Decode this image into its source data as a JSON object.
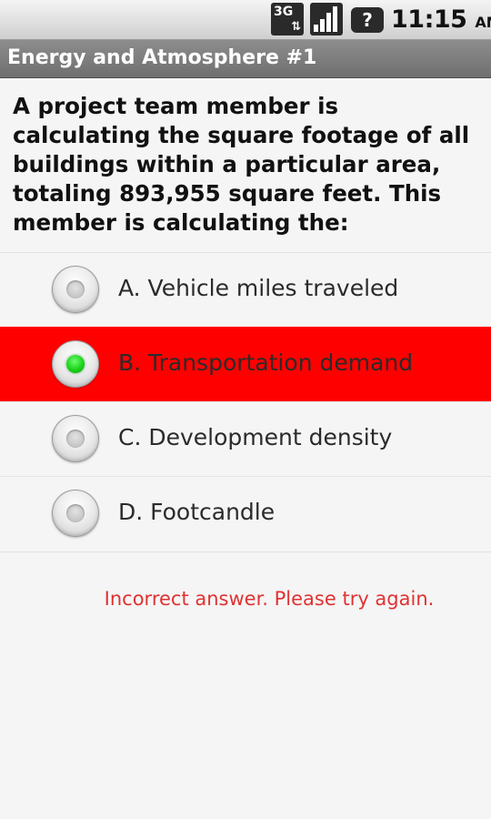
{
  "status_bar": {
    "network_type": "3G",
    "network_arrows": "⇅",
    "help_symbol": "?",
    "time": "11:15",
    "ampm": "AM",
    "icons": [
      "3g-icon",
      "signal-icon",
      "unknown-sim-icon"
    ]
  },
  "title_bar": {
    "title": "Energy and Atmosphere #1"
  },
  "question": {
    "text": "A project team member is calculating the square footage of all buildings within a particular area, totaling 893,955 square feet. This member is calculating the:"
  },
  "options": [
    {
      "label": "A. Vehicle miles traveled",
      "checked": false,
      "highlighted": false
    },
    {
      "label": "B. Transportation demand",
      "checked": true,
      "highlighted": true
    },
    {
      "label": "C. Development density",
      "checked": false,
      "highlighted": false
    },
    {
      "label": "D. Footcandle",
      "checked": false,
      "highlighted": false
    }
  ],
  "feedback": {
    "text": "Incorrect answer. Please try again."
  },
  "colors": {
    "selected_background": "#ff0000",
    "radio_checked": "#1ad41a",
    "feedback_text": "#e03232",
    "title_bar": "#7f7f7f"
  }
}
